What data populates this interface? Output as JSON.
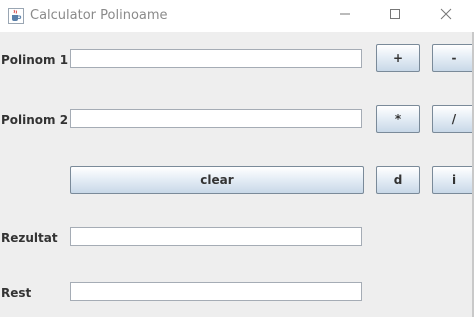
{
  "window": {
    "title": "Calculator Polinoame",
    "icon": "java-cup-icon",
    "controls": [
      "minimize-icon",
      "maximize-icon",
      "close-icon"
    ]
  },
  "form": {
    "polinom1_label": "Polinom 1",
    "polinom1_value": "",
    "polinom2_label": "Polinom 2",
    "polinom2_value": "",
    "rezultat_label": "Rezultat",
    "rezultat_value": "",
    "rest_label": "Rest",
    "rest_value": ""
  },
  "buttons": {
    "add": "+",
    "subtract": "-",
    "multiply": "*",
    "divide": "/",
    "clear": "clear",
    "derivative": "d",
    "integrate": "i"
  },
  "colors": {
    "background": "#eeeeee",
    "button_top": "#ffffff",
    "button_bottom": "#c8d8e8",
    "button_border": "#7a8a99",
    "field_border": "#a5acb5"
  }
}
